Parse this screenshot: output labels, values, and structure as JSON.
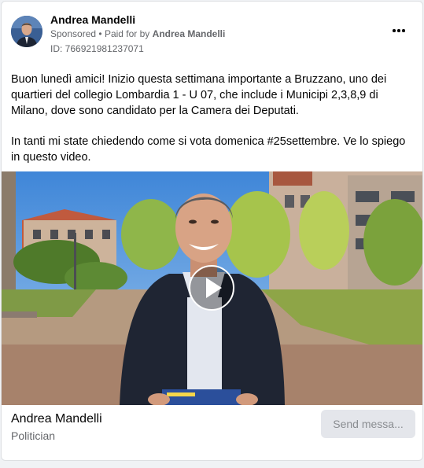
{
  "post": {
    "author_name": "Andrea Mandelli",
    "sponsored_label": "Sponsored",
    "separator": "•",
    "paid_for_prefix": "Paid for by",
    "paid_for_name": "Andrea Mandelli",
    "ad_id": "ID: 766921981237071",
    "body_paragraphs": [
      "Buon lunedì amici! Inizio questa settimana importante a Bruzzano, uno dei quartieri del collegio Lombardia 1 - U 07, che include i Municipi 2,3,8,9 di Milano, dove sono candidato per la Camera dei Deputati.",
      "In tanti mi state chiedendo come si vota domenica #25settembre. Ve lo spiego in questo video."
    ]
  },
  "footer": {
    "page_name": "Andrea Mandelli",
    "page_category": "Politician",
    "cta_label": "Send messa..."
  },
  "icons": {
    "more": "more-options-icon",
    "play": "play-icon"
  },
  "colors": {
    "primary_text": "#050505",
    "secondary_text": "#65676b",
    "button_bg": "#e4e6eb",
    "button_text": "#8a8d91"
  }
}
